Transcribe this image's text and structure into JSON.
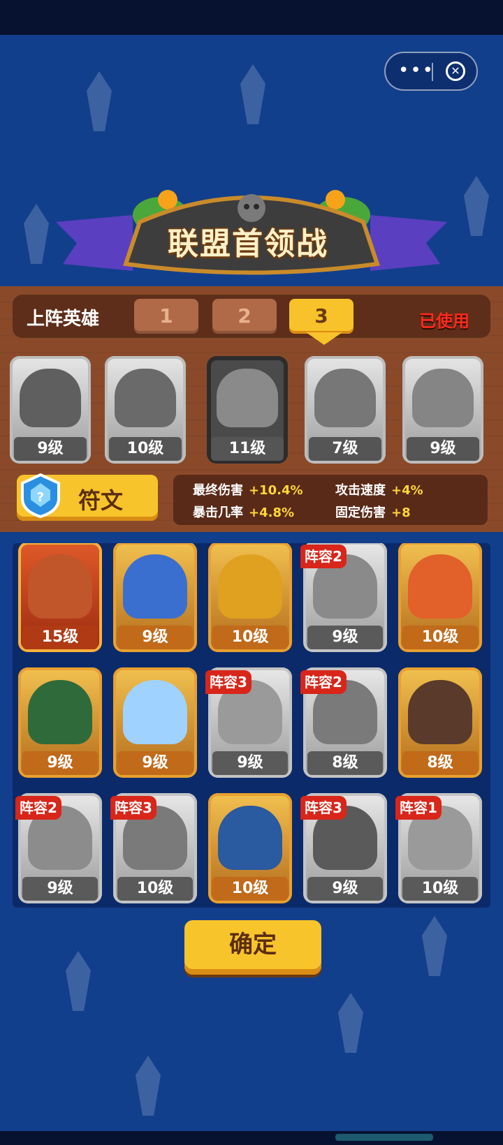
{
  "window": {
    "more_icon": "more-dots-icon",
    "close_icon": "close-circle-icon"
  },
  "banner": {
    "title": "联盟首领战"
  },
  "team": {
    "label": "上阵英雄",
    "tabs": [
      "1",
      "2",
      "3"
    ],
    "active_tab": "3",
    "status": "已使用"
  },
  "lineup": [
    {
      "level": "9级",
      "color": "#5f5f5f"
    },
    {
      "level": "10级",
      "color": "#6a6a6a"
    },
    {
      "level": "11级",
      "color": "#8a8a8a",
      "selected": true
    },
    {
      "level": "7级",
      "color": "#777777"
    },
    {
      "level": "9级",
      "color": "#858585"
    }
  ],
  "rune": {
    "label": "符文",
    "icon": "rune-shield-icon"
  },
  "stats": [
    {
      "name": "最终伤害",
      "value": "+10.4%"
    },
    {
      "name": "攻击速度",
      "value": "+4%"
    },
    {
      "name": "暴击几率",
      "value": "+4.8%"
    },
    {
      "name": "固定伤害",
      "value": "+8"
    }
  ],
  "roster": [
    {
      "level": "15级",
      "badge": "",
      "style": "red",
      "color": "#c0562a"
    },
    {
      "level": "9级",
      "badge": "",
      "style": "gold",
      "color": "#3a6fd0"
    },
    {
      "level": "10级",
      "badge": "",
      "style": "gold",
      "color": "#e0a020"
    },
    {
      "level": "9级",
      "badge": "阵容2",
      "style": "grey",
      "color": "#8a8a8a"
    },
    {
      "level": "10级",
      "badge": "",
      "style": "gold",
      "color": "#e2602a"
    },
    {
      "level": "9级",
      "badge": "",
      "style": "gold",
      "color": "#2f6a3a"
    },
    {
      "level": "9级",
      "badge": "",
      "style": "gold",
      "color": "#9fd2ff"
    },
    {
      "level": "9级",
      "badge": "阵容3",
      "style": "grey",
      "color": "#9a9a9a"
    },
    {
      "level": "8级",
      "badge": "阵容2",
      "style": "grey",
      "color": "#7a7a7a"
    },
    {
      "level": "8级",
      "badge": "",
      "style": "gold",
      "color": "#5a3a2a"
    },
    {
      "level": "9级",
      "badge": "阵容2",
      "style": "grey",
      "color": "#8c8c8c"
    },
    {
      "level": "10级",
      "badge": "阵容3",
      "style": "grey",
      "color": "#7a7a7a"
    },
    {
      "level": "10级",
      "badge": "",
      "style": "gold",
      "color": "#2a5aa0"
    },
    {
      "level": "9级",
      "badge": "阵容3",
      "style": "grey",
      "color": "#5a5a5a"
    },
    {
      "level": "10级",
      "badge": "阵容1",
      "style": "grey",
      "color": "#9a9a9a"
    }
  ],
  "confirm": {
    "label": "确定"
  }
}
